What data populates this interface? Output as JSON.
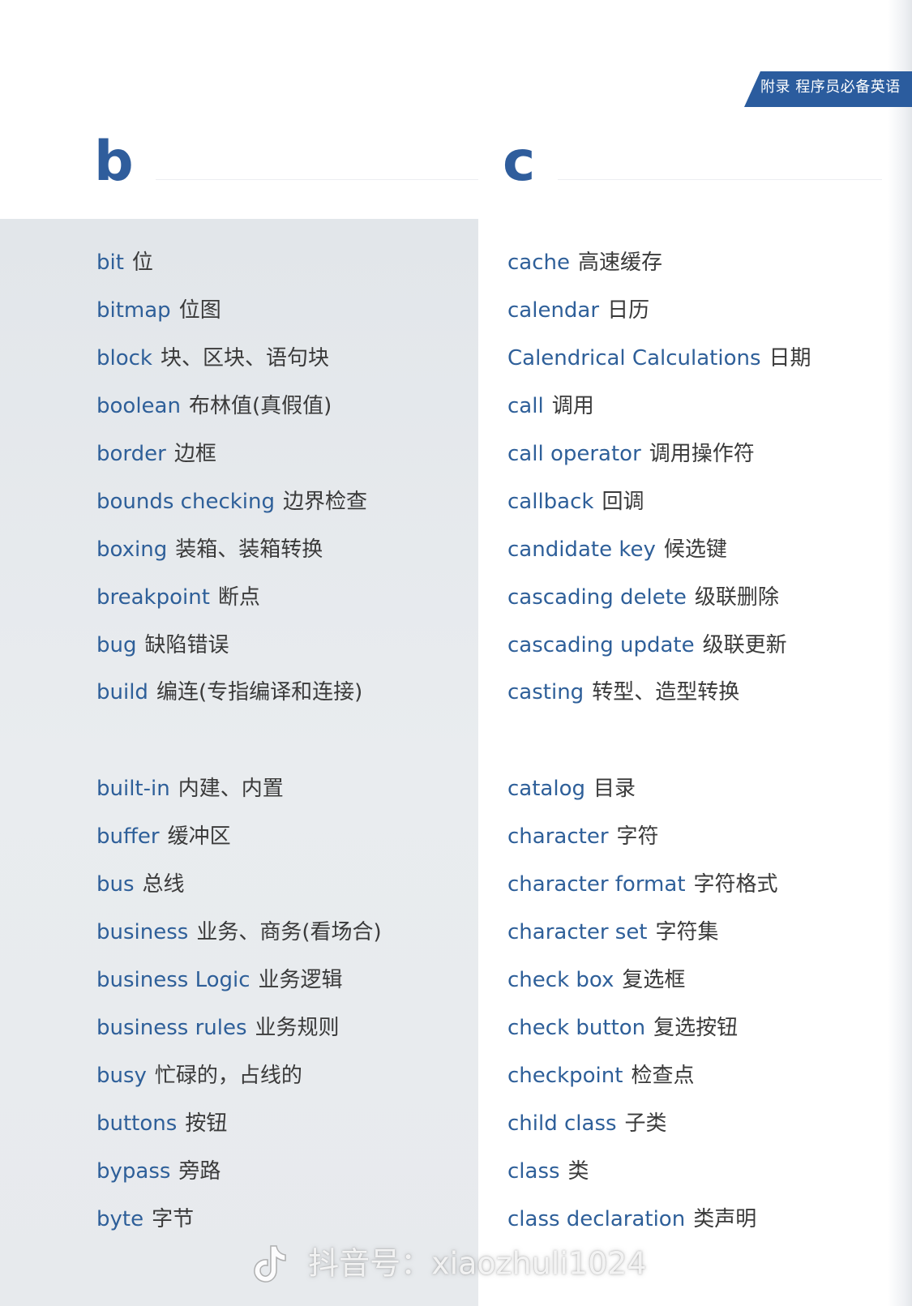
{
  "header": {
    "tab_label": "附录 程序员必备英语"
  },
  "sections": {
    "b": {
      "letter": "b",
      "entries": [
        {
          "en": "bit",
          "zh": "位"
        },
        {
          "en": "bitmap",
          "zh": "位图"
        },
        {
          "en": "block",
          "zh": "块、区块、语句块"
        },
        {
          "en": "boolean",
          "zh": "布林值(真假值)"
        },
        {
          "en": "border",
          "zh": "边框"
        },
        {
          "en": "bounds checking",
          "zh": "边界检查"
        },
        {
          "en": "boxing",
          "zh": "装箱、装箱转换"
        },
        {
          "en": "breakpoint",
          "zh": "断点"
        },
        {
          "en": "bug",
          "zh": "缺陷错误"
        },
        {
          "en": "build",
          "zh": "编连(专指编译和连接)"
        },
        {
          "en": "built-in",
          "zh": "内建、内置"
        },
        {
          "en": "buffer",
          "zh": "缓冲区"
        },
        {
          "en": "bus",
          "zh": "总线"
        },
        {
          "en": "business",
          "zh": "业务、商务(看场合)"
        },
        {
          "en": "business Logic",
          "zh": "业务逻辑"
        },
        {
          "en": "business rules",
          "zh": "业务规则"
        },
        {
          "en": "busy",
          "zh": "忙碌的，占线的"
        },
        {
          "en": "buttons",
          "zh": "按钮"
        },
        {
          "en": "bypass",
          "zh": "旁路"
        },
        {
          "en": "byte",
          "zh": "字节"
        }
      ]
    },
    "c": {
      "letter": "c",
      "entries": [
        {
          "en": "cache",
          "zh": "高速缓存"
        },
        {
          "en": "calendar",
          "zh": "日历"
        },
        {
          "en": "Calendrical Calculations",
          "zh": "日期"
        },
        {
          "en": "call",
          "zh": "调用"
        },
        {
          "en": "call operator",
          "zh": "调用操作符"
        },
        {
          "en": "callback",
          "zh": "回调"
        },
        {
          "en": "candidate key",
          "zh": "候选键"
        },
        {
          "en": "cascading delete",
          "zh": "级联删除"
        },
        {
          "en": "cascading update",
          "zh": "级联更新"
        },
        {
          "en": "casting",
          "zh": "转型、造型转换"
        },
        {
          "en": "catalog",
          "zh": "目录"
        },
        {
          "en": "character",
          "zh": "字符"
        },
        {
          "en": "character format",
          "zh": "字符格式"
        },
        {
          "en": "character set",
          "zh": "字符集"
        },
        {
          "en": "check box",
          "zh": "复选框"
        },
        {
          "en": "check button",
          "zh": "复选按钮"
        },
        {
          "en": "checkpoint",
          "zh": "检查点"
        },
        {
          "en": "child class",
          "zh": "子类"
        },
        {
          "en": "class",
          "zh": "类"
        },
        {
          "en": "class declaration",
          "zh": "类声明"
        }
      ]
    }
  },
  "watermark": {
    "icon": "tiktok-icon",
    "text": "抖音号：xiaozhuli1024"
  },
  "colors": {
    "accent": "#2b5c9e",
    "term_en": "#2e5f99",
    "term_zh": "#3a3a3a",
    "panel": "#e6e9ec"
  }
}
